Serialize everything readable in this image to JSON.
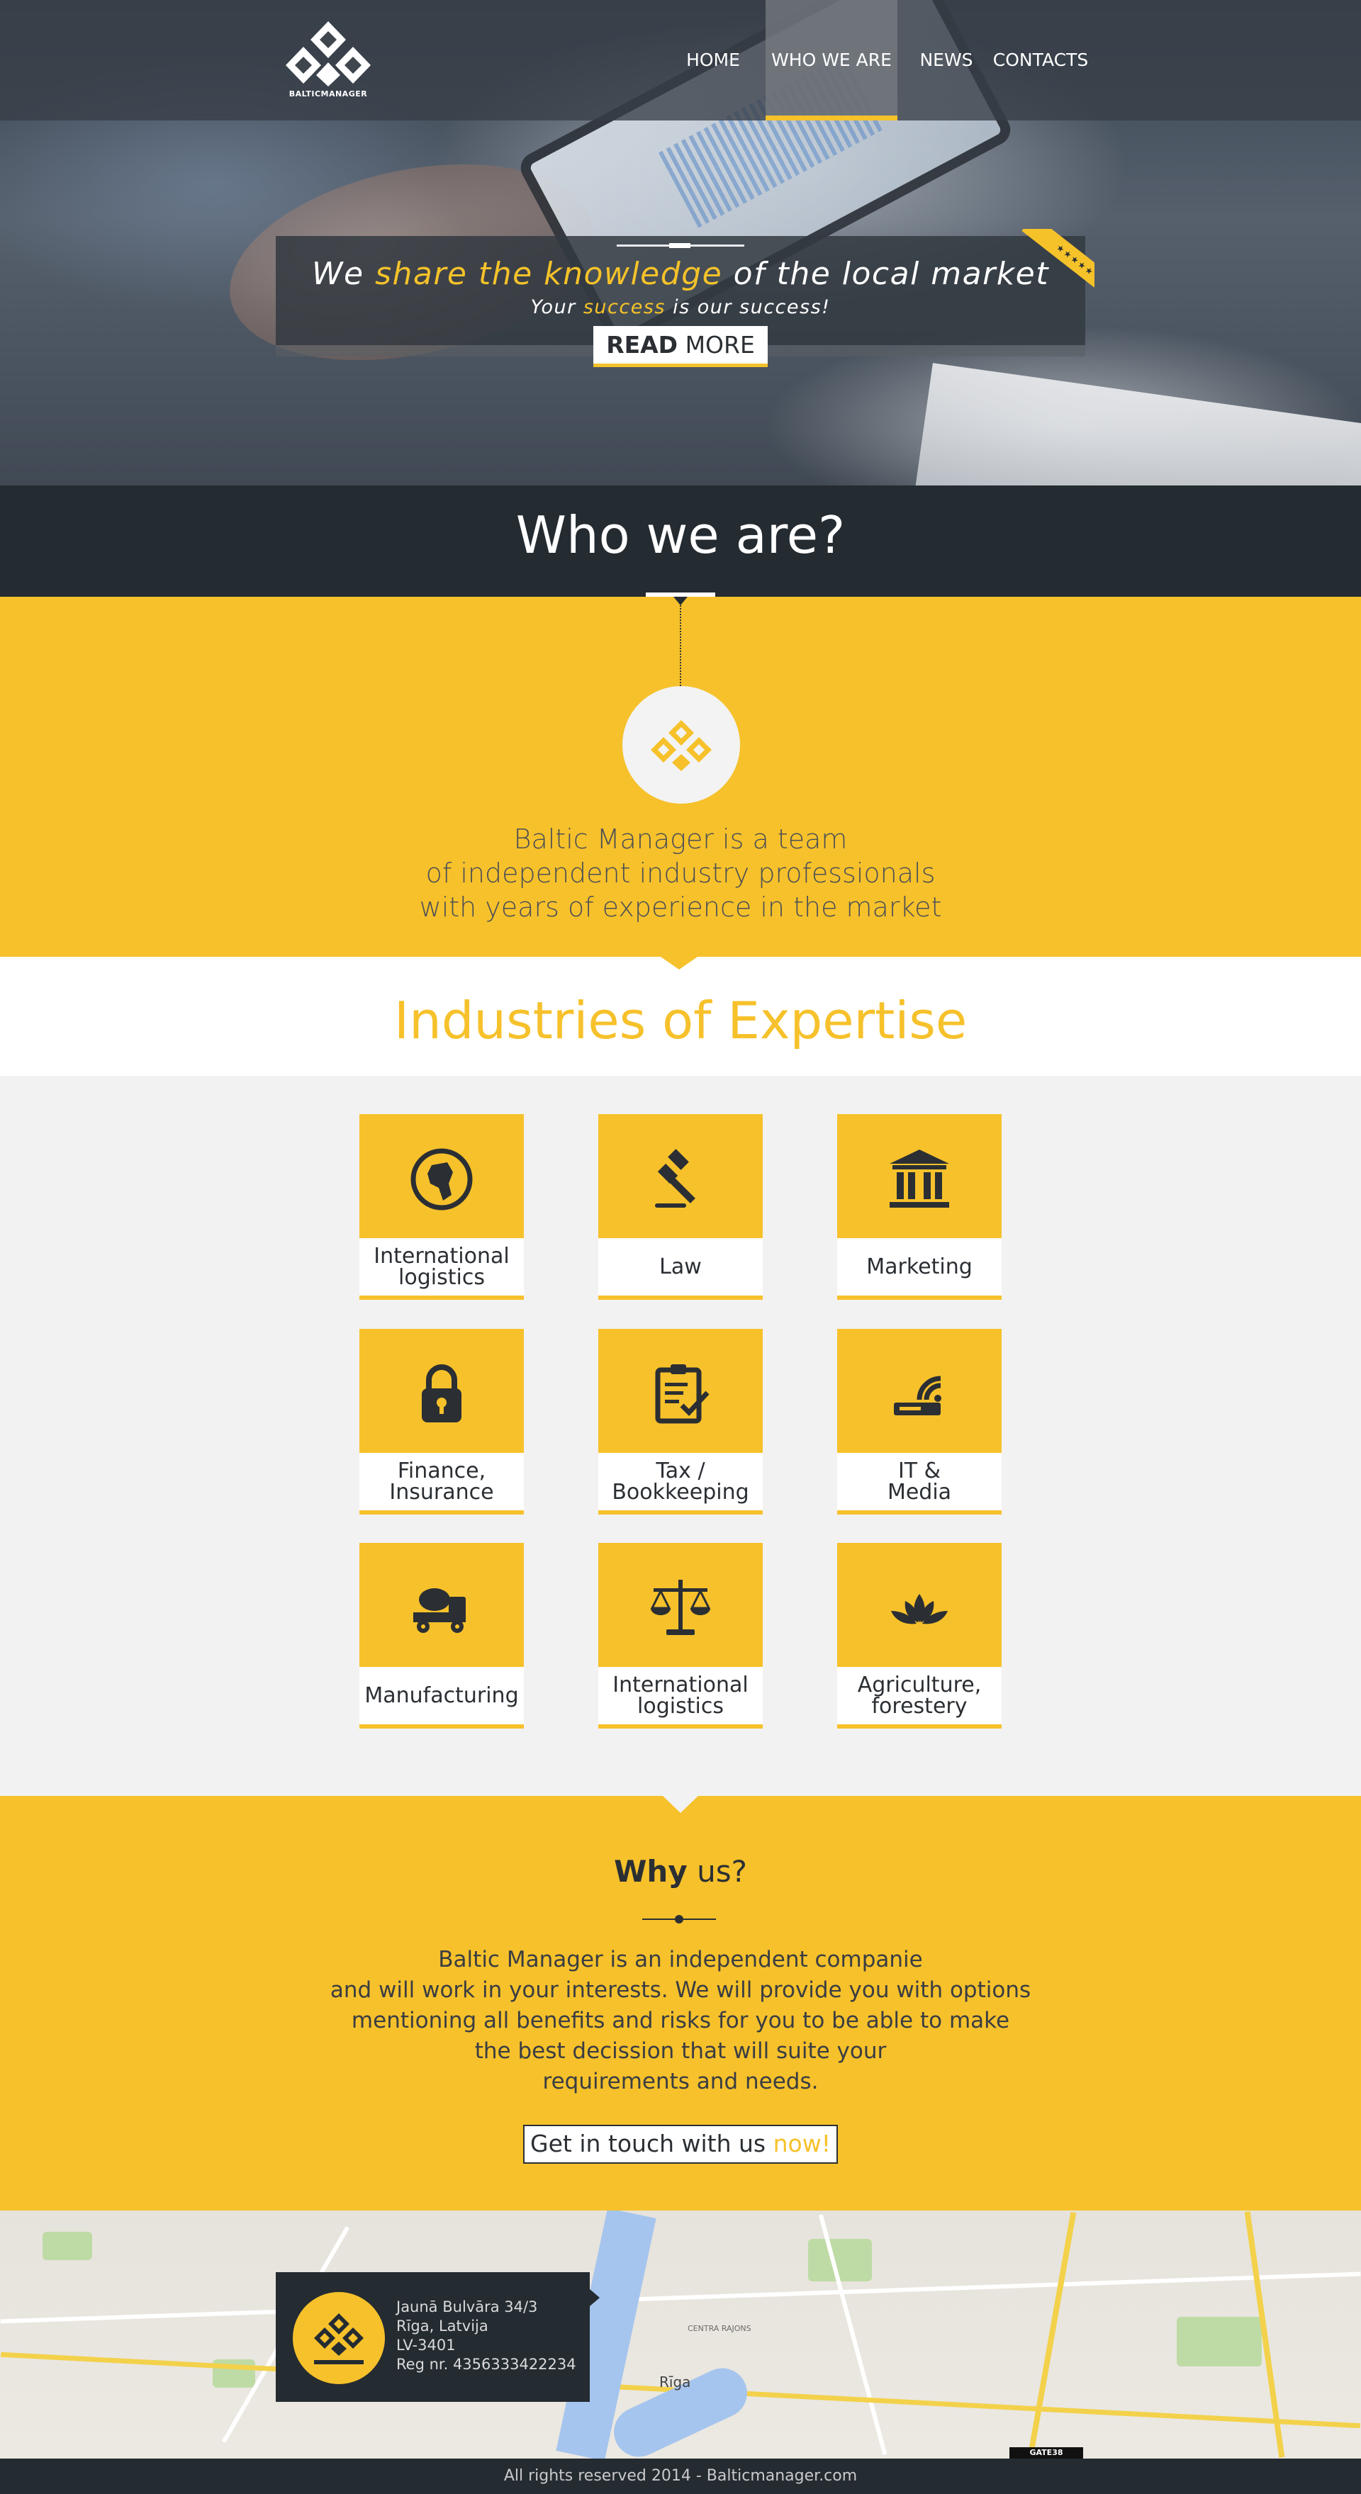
{
  "brand": {
    "name": "BALTICMANAGER"
  },
  "nav": {
    "items": [
      {
        "label": "HOME"
      },
      {
        "label": "WHO WE ARE",
        "active": true
      },
      {
        "label": "NEWS"
      },
      {
        "label": "CONTACTS"
      }
    ]
  },
  "hero": {
    "headline_pre": "We ",
    "headline_highlight": "share the knowledge",
    "headline_post": " of the local market",
    "sub_pre": "Your ",
    "sub_highlight": "success",
    "sub_post": " is our success!",
    "ribbon_stars": "★★★★★",
    "readmore_bold": "READ",
    "readmore_rest": " MORE"
  },
  "who": {
    "title": "Who we are?",
    "lines": [
      "Baltic Manager is a team",
      "of independent industry professionals",
      "with years of experience in the market"
    ]
  },
  "industries": {
    "title": "Industries of Expertise",
    "cards": [
      {
        "icon": "globe-icon",
        "line1": "International",
        "line2": "logistics"
      },
      {
        "icon": "gavel-icon",
        "line1": "Law",
        "line2": ""
      },
      {
        "icon": "bank-icon",
        "line1": "Marketing",
        "line2": ""
      },
      {
        "icon": "lock-icon",
        "line1": "Finance,",
        "line2": "Insurance"
      },
      {
        "icon": "clipboard-icon",
        "line1": "Tax /",
        "line2": "Bookkeeping"
      },
      {
        "icon": "router-icon",
        "line1": "IT &",
        "line2": "Media"
      },
      {
        "icon": "mixer-truck-icon",
        "line1": "Manufacturing",
        "line2": ""
      },
      {
        "icon": "scales-icon",
        "line1": "International",
        "line2": "logistics"
      },
      {
        "icon": "lotus-icon",
        "line1": "Agriculture,",
        "line2": "forestery"
      }
    ]
  },
  "why": {
    "title_bold": "Why",
    "title_rest": " us?",
    "lines": [
      "Baltic Manager is an independent companie",
      "and will work in your interests. We will provide you with options",
      "mentioning all benefits and risks for you to be able to make",
      "the best decission that will suite your",
      "requirements and needs."
    ],
    "cta_pre": "Get in touch with us ",
    "cta_highlight": "now!"
  },
  "contact": {
    "street": "Jaunā Bulvāra 34/3",
    "city": "Rīga, Latvija",
    "zip": "LV-3401",
    "reg": "Reg nr. 4356333422234"
  },
  "map": {
    "city_label": "Rīga",
    "district_label": "CENTRA RAJONS",
    "gate_label": "GATE38"
  },
  "footer": {
    "text": "All rights reserved 2014 - Balticmanager.com"
  },
  "colors": {
    "accent": "#f6c12b",
    "dark": "#242b31"
  }
}
